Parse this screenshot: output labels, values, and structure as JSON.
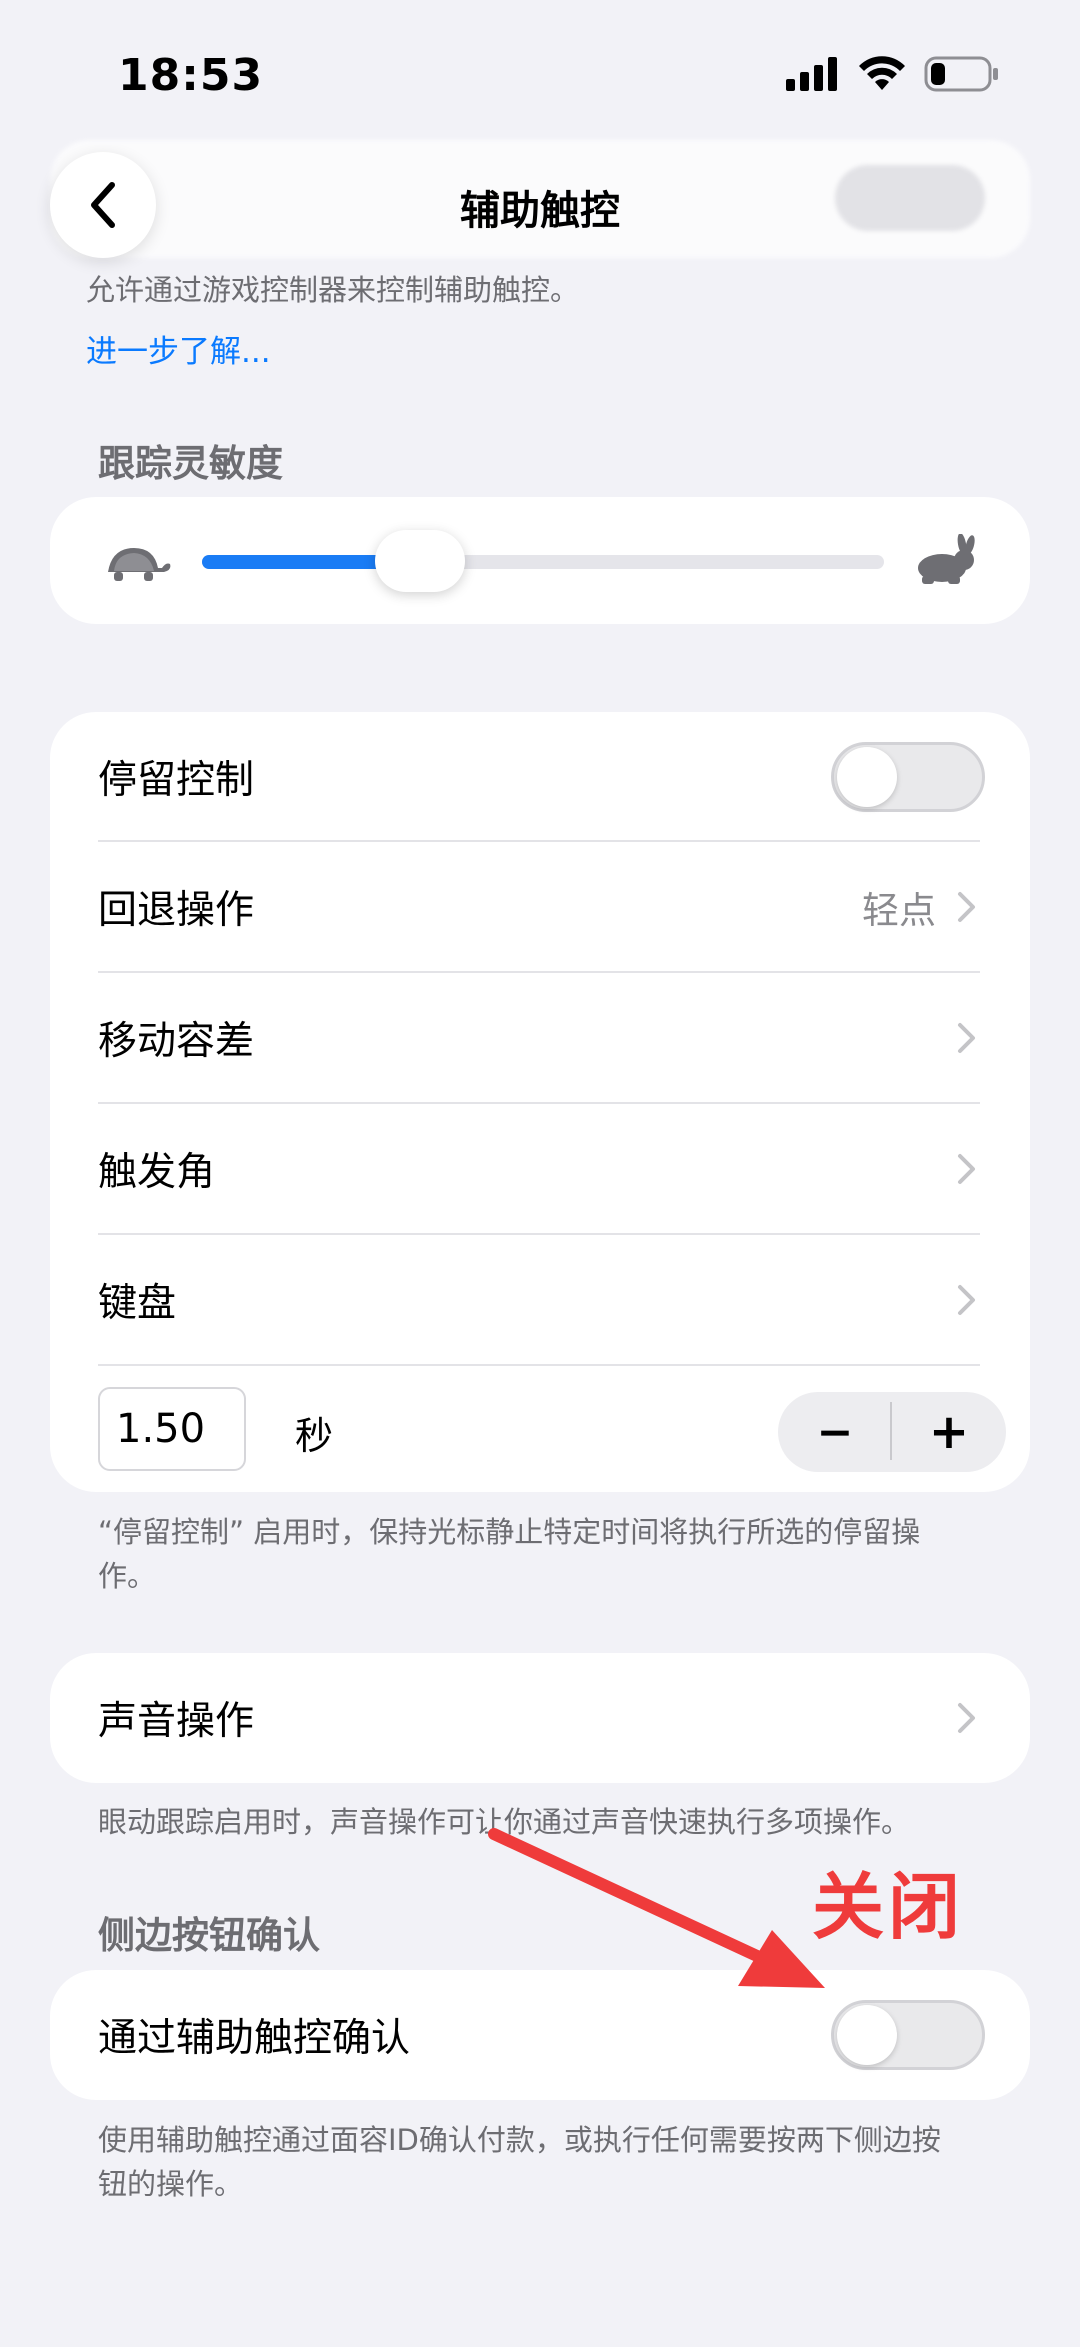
{
  "status_bar": {
    "time": "18:53"
  },
  "nav": {
    "title": "辅助触控",
    "back_icon": "chevron-left-icon"
  },
  "game_controller": {
    "description": "允许通过游戏控制器来控制辅助触控。",
    "learn_more": "进一步了解..."
  },
  "tracking_sensitivity": {
    "header": "跟踪灵敏度",
    "slow_icon": "turtle-icon",
    "fast_icon": "rabbit-icon",
    "value": 0.32,
    "accent": "#1a7cf5"
  },
  "dwell_group": {
    "rows": [
      {
        "label": "停留控制",
        "type": "toggle",
        "on": false
      },
      {
        "label": "回退操作",
        "value": "轻点",
        "type": "disclosure"
      },
      {
        "label": "移动容差",
        "type": "disclosure"
      },
      {
        "label": "触发角",
        "type": "disclosure"
      },
      {
        "label": "键盘",
        "type": "disclosure"
      }
    ],
    "duration_value": "1.50",
    "duration_unit": "秒",
    "decrement_label": "−",
    "increment_label": "+",
    "footnote": "“停留控制” 启用时，保持光标静止特定时间将执行所选的停留操作。"
  },
  "voice_actions": {
    "label": "声音操作",
    "footnote": "眼动跟踪启用时，声音操作可让你通过声音快速执行多项操作。"
  },
  "side_button": {
    "header": "侧边按钮确认",
    "label": "通过辅助触控确认",
    "on": false,
    "footnote": "使用辅助触控通过面容ID确认付款，或执行任何需要按两下侧边按钮的操作。"
  },
  "annotation": {
    "text": "关闭",
    "color": "#ef3b3b"
  }
}
